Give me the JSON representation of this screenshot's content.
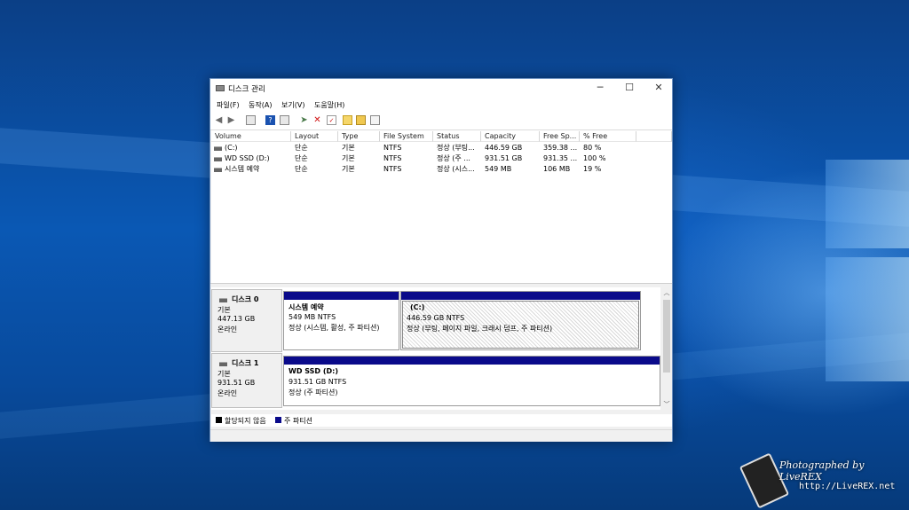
{
  "window": {
    "title": "디스크 관리",
    "minimize": "─",
    "maximize": "☐",
    "close": "✕"
  },
  "menu": [
    "파일(F)",
    "동작(A)",
    "보기(V)",
    "도움말(H)"
  ],
  "toolbar": {
    "icons": [
      "back-icon",
      "forward-icon",
      "view-icon",
      "help-icon",
      "view2-icon",
      "connect-icon",
      "delete-icon",
      "properties-icon",
      "new-icon",
      "open-icon",
      "settings-icon"
    ],
    "colors": {
      "delete": "#d01010",
      "help": "#1a52b0",
      "arrow": "#6a6a6a"
    }
  },
  "volumes": {
    "columns": [
      "Volume",
      "Layout",
      "Type",
      "File System",
      "Status",
      "Capacity",
      "Free Sp...",
      "% Free"
    ],
    "rows": [
      [
        "(C:)",
        "단순",
        "기본",
        "NTFS",
        "정상 (부팅...",
        "446.59 GB",
        "359.38 ...",
        "80 %"
      ],
      [
        "WD SSD (D:)",
        "단순",
        "기본",
        "NTFS",
        "정상 (주 ...",
        "931.51 GB",
        "931.35 ...",
        "100 %"
      ],
      [
        "시스템 예약",
        "단순",
        "기본",
        "NTFS",
        "정상 (시스...",
        "549 MB",
        "106 MB",
        "19 %"
      ]
    ]
  },
  "disks": [
    {
      "name": "디스크 0",
      "type": "기본",
      "size": "447.13 GB",
      "state": "온라인",
      "partitions": [
        {
          "name": "시스템 예약",
          "size": "549 MB NTFS",
          "status": "정상 (시스템, 활성, 주 파티션)"
        },
        {
          "name": "(C:)",
          "size": "446.59 GB NTFS",
          "status": "정상 (부팅, 페이지 파일, 크래시 덤프, 주 파티션)"
        }
      ]
    },
    {
      "name": "디스크 1",
      "type": "기본",
      "size": "931.51 GB",
      "state": "온라인",
      "partitions": [
        {
          "name": "WD SSD  (D:)",
          "size": "931.51 GB NTFS",
          "status": "정상 (주 파티션)"
        }
      ]
    }
  ],
  "legend": {
    "items": [
      {
        "label": "할당되지 않음",
        "color": "#000000"
      },
      {
        "label": "주 파티션",
        "color": "#0a0a8a"
      }
    ]
  },
  "scrollbar": {
    "up": "︿",
    "down": "﹀"
  },
  "watermark": {
    "line1": "Photographed by LiveREX",
    "line2": "http://LiveREX.net"
  }
}
